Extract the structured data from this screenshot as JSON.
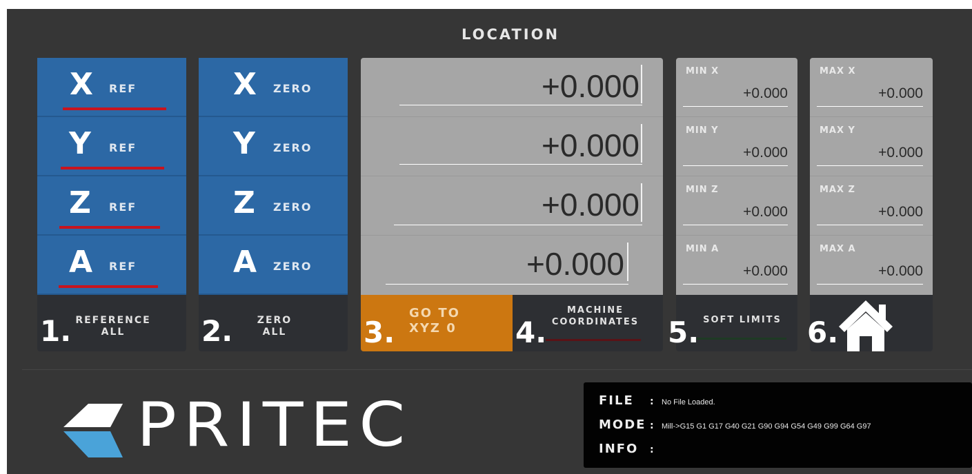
{
  "header": {
    "title": "LOCATION"
  },
  "reference": {
    "items": [
      {
        "axis": "X",
        "sub": "REF"
      },
      {
        "axis": "Y",
        "sub": "REF"
      },
      {
        "axis": "Z",
        "sub": "REF"
      },
      {
        "axis": "A",
        "sub": "REF"
      }
    ],
    "all_line1": "REFERENCE",
    "all_line2": "ALL",
    "number": "1."
  },
  "zero": {
    "items": [
      {
        "axis": "X",
        "sub": "ZERO"
      },
      {
        "axis": "Y",
        "sub": "ZERO"
      },
      {
        "axis": "Z",
        "sub": "ZERO"
      },
      {
        "axis": "A",
        "sub": "ZERO"
      }
    ],
    "all_line1": "ZERO",
    "all_line2": "ALL",
    "number": "2."
  },
  "dro": {
    "values": [
      "+0.000",
      "+0.000",
      "+0.000",
      "+0.000"
    ]
  },
  "goto": {
    "line1": "GO TO",
    "line2": "XYZ 0",
    "number": "3.",
    "color": "#cc7711"
  },
  "machine": {
    "line1": "MACHINE",
    "line2": "COORDINATES",
    "number": "4."
  },
  "softlimits": {
    "min": [
      {
        "label": "MIN X",
        "value": "+0.000"
      },
      {
        "label": "MIN Y",
        "value": "+0.000"
      },
      {
        "label": "MIN Z",
        "value": "+0.000"
      },
      {
        "label": "MIN A",
        "value": "+0.000"
      }
    ],
    "max": [
      {
        "label": "MAX X",
        "value": "+0.000"
      },
      {
        "label": "MAX Y",
        "value": "+0.000"
      },
      {
        "label": "MAX Z",
        "value": "+0.000"
      },
      {
        "label": "MAX A",
        "value": "+0.000"
      }
    ],
    "label": "SOFT LIMITS",
    "number": "5."
  },
  "home": {
    "number": "6.",
    "icon": "home-icon"
  },
  "logo": {
    "text": "PRITEC"
  },
  "info": {
    "file_label": "FILE",
    "file_value": "No File Loaded.",
    "mode_label": "MODE",
    "mode_value": "Mill->G15  G1 G17 G40 G21 G90 G94 G54 G49 G99 G64 G97",
    "info_label": "INFO",
    "info_value": ""
  },
  "colors": {
    "blue": "#2c68a5",
    "orange": "#cc7711",
    "ref_red": "#c8141e",
    "background": "#363636"
  }
}
